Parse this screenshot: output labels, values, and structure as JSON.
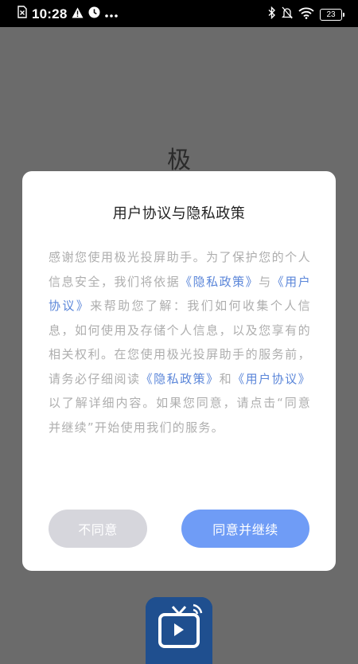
{
  "status_bar": {
    "time": "10:28",
    "battery": "23",
    "left_icons": [
      "sim-x-icon",
      "warning-icon",
      "clock-app-icon",
      "more-dots-icon"
    ],
    "right_icons": [
      "bluetooth-icon",
      "silent-icon",
      "wifi-icon",
      "battery-icon"
    ]
  },
  "background": {
    "title": "极"
  },
  "dialog": {
    "title": "用户协议与隐私政策",
    "body": {
      "t1": "感谢您使用极光投屏助手。为了保护您的个人信息安全，我们将依据",
      "link_privacy_1": "《隐私政策》",
      "t2": "与",
      "link_user_1": "《用户协议》",
      "t3": "来帮助您了解：我们如何收集个人信息，如何使用及存储个人信息，以及您享有的相关权利。在您使用极光投屏助手的服务前，请务必仔细阅读",
      "link_privacy_2": "《隐私政策》",
      "t4": "和",
      "link_user_2": "《用户协议》",
      "t5": "以了解详细内容。如果您同意，请点击“同意并继续”开始使用我们的服务。"
    },
    "buttons": {
      "disagree": "不同意",
      "agree": "同意并继续"
    }
  },
  "colors": {
    "link": "#5b86d9",
    "agree_button": "#6f9cf6",
    "disagree_button": "#d6d6dc",
    "overlay": "#6b6b6b"
  }
}
